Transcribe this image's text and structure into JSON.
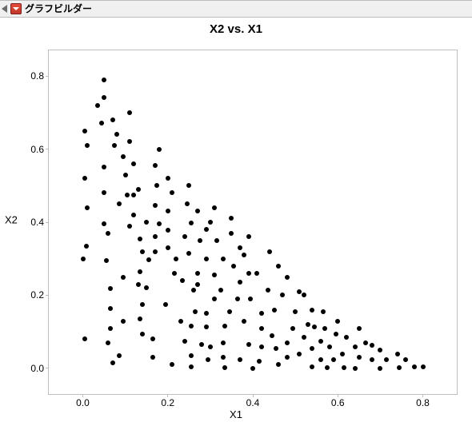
{
  "header": {
    "title": "グラフビルダー"
  },
  "chart_data": {
    "type": "scatter",
    "title": "X2 vs. X1",
    "xlabel": "X1",
    "ylabel": "X2",
    "xlim": [
      -0.08,
      0.88
    ],
    "ylim": [
      -0.07,
      0.87
    ],
    "x_ticks": [
      0.0,
      0.2,
      0.4,
      0.6,
      0.8
    ],
    "y_ticks": [
      0.0,
      0.2,
      0.4,
      0.6,
      0.8
    ],
    "x": [
      0.05,
      0.05,
      0.035,
      0.045,
      0.07,
      0.005,
      0.01,
      0.075,
      0.005,
      0.05,
      0.05,
      0.01,
      0.085,
      0.05,
      0.008,
      0.06,
      0.0,
      0.095,
      0.085,
      0.005,
      0.055,
      0.065,
      0.065,
      0.065,
      0.095,
      0.06,
      0.07,
      0.11,
      0.08,
      0.11,
      0.095,
      0.1,
      0.12,
      0.105,
      0.12,
      0.13,
      0.12,
      0.11,
      0.135,
      0.14,
      0.15,
      0.135,
      0.13,
      0.14,
      0.15,
      0.155,
      0.135,
      0.165,
      0.14,
      0.165,
      0.18,
      0.17,
      0.175,
      0.17,
      0.18,
      0.2,
      0.17,
      0.17,
      0.2,
      0.21,
      0.2,
      0.21,
      0.2,
      0.215,
      0.195,
      0.24,
      0.22,
      0.235,
      0.23,
      0.24,
      0.25,
      0.245,
      0.255,
      0.25,
      0.27,
      0.26,
      0.265,
      0.255,
      0.255,
      0.28,
      0.255,
      0.27,
      0.275,
      0.29,
      0.27,
      0.29,
      0.29,
      0.3,
      0.31,
      0.29,
      0.295,
      0.31,
      0.3,
      0.315,
      0.31,
      0.325,
      0.33,
      0.33,
      0.335,
      0.345,
      0.33,
      0.335,
      0.35,
      0.35,
      0.37,
      0.355,
      0.365,
      0.37,
      0.37,
      0.38,
      0.39,
      0.39,
      0.38,
      0.39,
      0.4,
      0.395,
      0.42,
      0.42,
      0.42,
      0.415,
      0.44,
      0.41,
      0.435,
      0.46,
      0.45,
      0.445,
      0.455,
      0.46,
      0.48,
      0.47,
      0.48,
      0.495,
      0.48,
      0.51,
      0.5,
      0.51,
      0.52,
      0.52,
      0.54,
      0.53,
      0.54,
      0.54,
      0.56,
      0.545,
      0.56,
      0.565,
      0.575,
      0.57,
      0.58,
      0.59,
      0.595,
      0.6,
      0.61,
      0.62,
      0.615,
      0.64,
      0.65,
      0.65,
      0.665,
      0.64,
      0.68,
      0.68,
      0.7,
      0.7,
      0.715,
      0.74,
      0.745,
      0.76,
      0.78,
      0.8
    ],
    "y": [
      0.79,
      0.74,
      0.72,
      0.67,
      0.68,
      0.65,
      0.61,
      0.61,
      0.52,
      0.55,
      0.48,
      0.44,
      0.45,
      0.395,
      0.335,
      0.37,
      0.3,
      0.13,
      0.035,
      0.08,
      0.295,
      0.218,
      0.165,
      0.11,
      0.25,
      0.07,
      0.015,
      0.7,
      0.64,
      0.62,
      0.58,
      0.53,
      0.56,
      0.475,
      0.475,
      0.49,
      0.42,
      0.39,
      0.355,
      0.32,
      0.4,
      0.265,
      0.23,
      0.175,
      0.22,
      0.298,
      0.135,
      0.08,
      0.095,
      0.03,
      0.6,
      0.555,
      0.5,
      0.445,
      0.395,
      0.378,
      0.36,
      0.32,
      0.33,
      0.01,
      0.52,
      0.48,
      0.43,
      0.26,
      0.175,
      0.36,
      0.3,
      0.24,
      0.13,
      0.075,
      0.5,
      0.45,
      0.398,
      0.315,
      0.26,
      0.215,
      0.155,
      0.115,
      0.035,
      0.065,
      0.005,
      0.43,
      0.35,
      0.3,
      0.23,
      0.38,
      0.15,
      0.06,
      0.19,
      0.113,
      0.025,
      0.44,
      0.4,
      0.35,
      0.255,
      0.215,
      0.3,
      0.07,
      0.115,
      0.155,
      0.03,
      0.003,
      0.41,
      0.37,
      0.33,
      0.28,
      0.19,
      0.235,
      0.025,
      0.13,
      0.065,
      0.36,
      0.31,
      0.26,
      0.0,
      0.19,
      0.06,
      0.11,
      0.15,
      0.02,
      0.32,
      0.26,
      0.215,
      0.28,
      0.16,
      0.09,
      0.055,
      0.01,
      0.25,
      0.2,
      0.03,
      0.11,
      0.07,
      0.21,
      0.155,
      0.04,
      0.2,
      0.085,
      0.16,
      0.12,
      0.005,
      0.055,
      0.025,
      0.113,
      0.075,
      0.155,
      0.003,
      0.11,
      0.06,
      0.023,
      0.095,
      0.13,
      0.04,
      0.085,
      0.003,
      0.06,
      0.11,
      0.03,
      0.07,
      0.0,
      0.025,
      0.063,
      0.05,
      0.0,
      0.025,
      0.04,
      0.003,
      0.025,
      0.005,
      0.005
    ]
  }
}
